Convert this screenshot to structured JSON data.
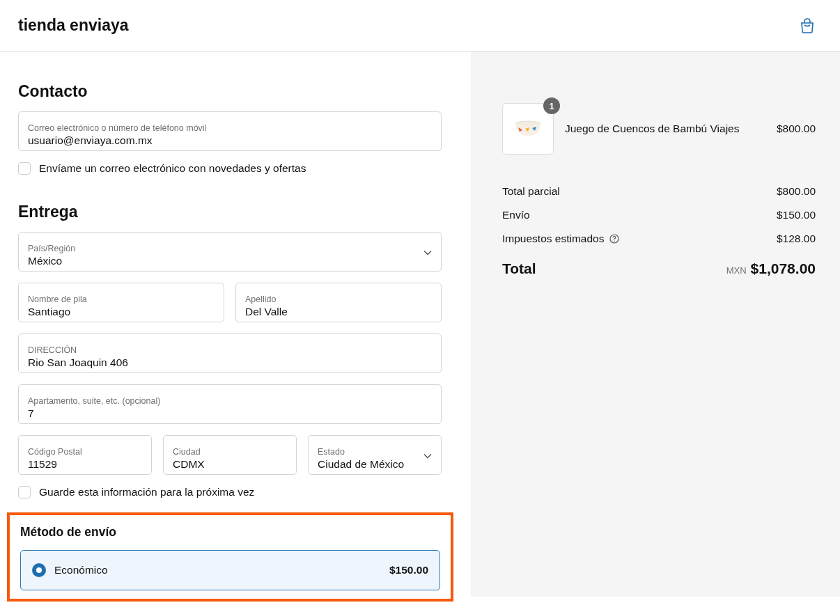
{
  "header": {
    "store_name": "tienda enviaya"
  },
  "contact": {
    "title": "Contacto",
    "field": {
      "label": "Correo electrónico o número de teléfono móvil",
      "value": "usuario@enviaya.com.mx"
    },
    "newsletter": {
      "label": "Envíame un correo electrónico con novedades y ofertas",
      "checked": false
    }
  },
  "delivery": {
    "title": "Entrega",
    "rows": [
      [
        {
          "kind": "select",
          "label": "País/Región",
          "value": "México"
        }
      ],
      [
        {
          "kind": "text",
          "label": "Nombre de pila",
          "value": "Santiago"
        },
        {
          "kind": "text",
          "label": "Apellido",
          "value": "Del Valle"
        }
      ],
      [
        {
          "kind": "text",
          "label": "DIRECCIÓN",
          "value": "Rio San Joaquin 406"
        }
      ],
      [
        {
          "kind": "text",
          "label": "Apartamento, suite, etc. (opcional)",
          "value": "7"
        }
      ],
      [
        {
          "kind": "text",
          "label": "Código Postal",
          "value": "11529"
        },
        {
          "kind": "text",
          "label": "Ciudad",
          "value": "CDMX"
        },
        {
          "kind": "select",
          "label": "Estado",
          "value": "Ciudad de México"
        }
      ]
    ],
    "save_info": {
      "label": "Guarde esta información para la próxima vez",
      "checked": false
    }
  },
  "shipping": {
    "title": "Método de envío",
    "highlighted": true,
    "options": [
      {
        "label": "Económico",
        "price": "$150.00",
        "selected": true
      }
    ]
  },
  "summary": {
    "items": [
      {
        "quantity": "1",
        "name": "Juego de Cuencos de Bambú Viajes",
        "price": "$800.00"
      }
    ],
    "lines": [
      {
        "label": "Total parcial",
        "value": "$800.00",
        "help": false
      },
      {
        "label": "Envío",
        "value": "$150.00",
        "help": false
      },
      {
        "label": "Impuestos estimados",
        "value": "$128.00",
        "help": true
      }
    ],
    "total": {
      "label": "Total",
      "currency": "MXN",
      "value": "$1,078.00"
    }
  }
}
